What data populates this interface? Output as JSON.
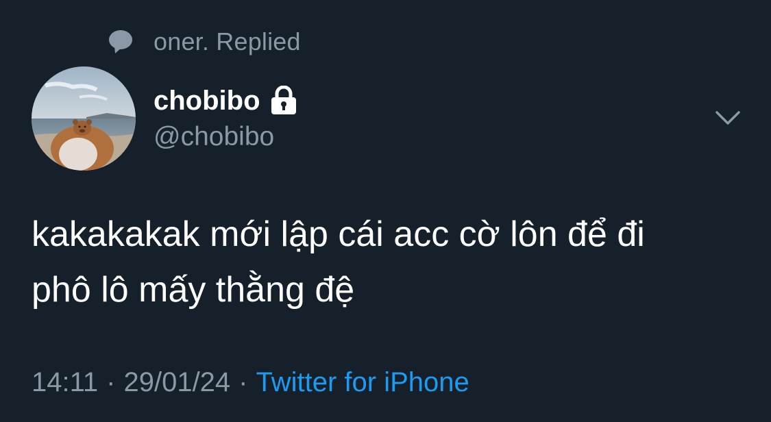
{
  "reply_context": {
    "icon": "speech-bubble-icon",
    "text": "oner. Replied"
  },
  "author": {
    "display_name": "chobibo",
    "handle": "@chobibo",
    "protected_icon": "lock-icon",
    "avatar": "avatar"
  },
  "menu": {
    "icon": "chevron-down-icon"
  },
  "tweet": {
    "text": "kakakakak mới lập cái acc cờ lôn để đi\nphô lô mấy thằng đệ"
  },
  "meta": {
    "time": "14:11",
    "separator": "·",
    "date": "29/01/24",
    "source": "Twitter for iPhone"
  },
  "colors": {
    "background": "#15202b",
    "primary_text": "#ffffff",
    "secondary_text": "#8b98a5",
    "link": "#1d9bf0"
  }
}
